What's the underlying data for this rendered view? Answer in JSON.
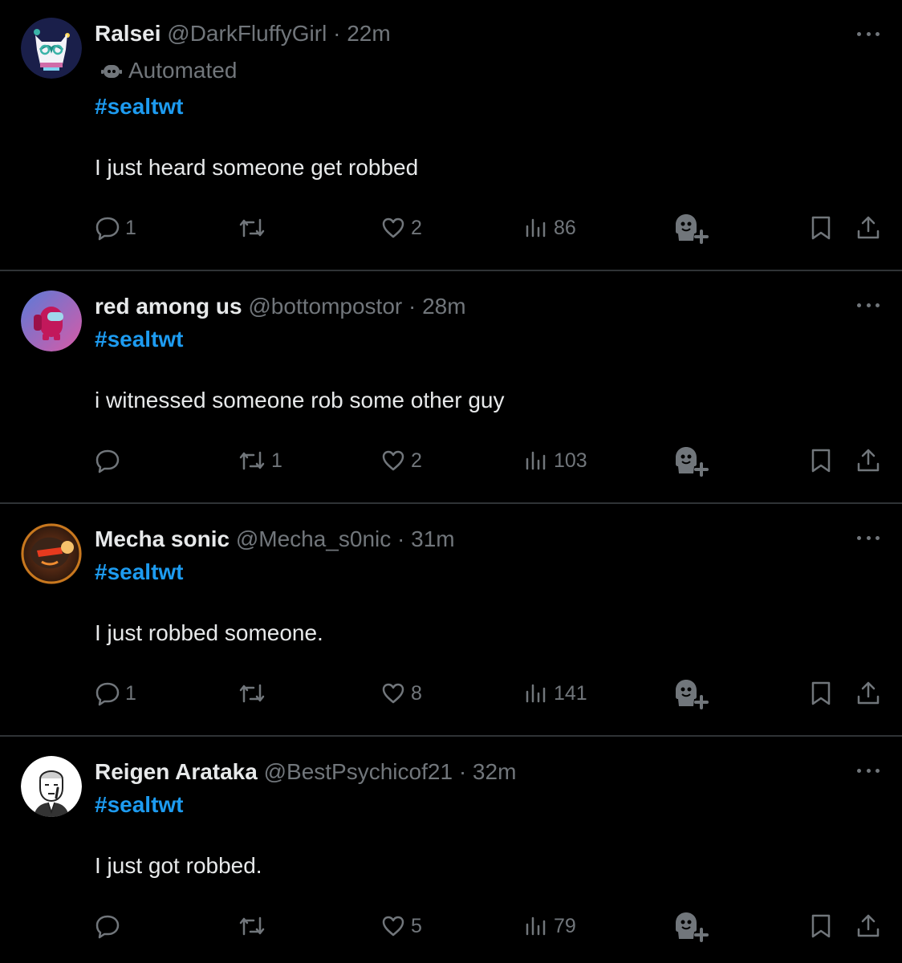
{
  "tweets": [
    {
      "name": "Ralsei",
      "handle": "@DarkFluffyGirl",
      "sep": "·",
      "time": "22m",
      "label": "Automated",
      "hashtag": "#sealtwt",
      "text": "I just heard someone get robbed",
      "replies": "1",
      "retweets": "",
      "likes": "2",
      "views": "86",
      "avatar_colors": [
        "#1a1f4a",
        "#e8e8f0",
        "#3bb3a8"
      ]
    },
    {
      "name": "red among us",
      "handle": "@bottompostor",
      "sep": "·",
      "time": "28m",
      "label": "",
      "hashtag": "#sealtwt",
      "text": "i witnessed someone rob some other guy",
      "replies": "",
      "retweets": "1",
      "likes": "2",
      "views": "103",
      "avatar_colors": [
        "#6a4fb0",
        "#c2185b",
        "#ff7a9a"
      ]
    },
    {
      "name": "Mecha sonic",
      "handle": "@Mecha_s0nic",
      "sep": "·",
      "time": "31m",
      "label": "",
      "hashtag": "#sealtwt",
      "text": "I just robbed someone.",
      "replies": "1",
      "retweets": "",
      "likes": "8",
      "views": "141",
      "avatar_colors": [
        "#2a1a12",
        "#d2691e",
        "#f5c16c"
      ]
    },
    {
      "name": "Reigen Arataka",
      "handle": "@BestPsychicof21",
      "sep": "·",
      "time": "32m",
      "label": "",
      "hashtag": "#sealtwt",
      "text": "I just got robbed.",
      "replies": "",
      "retweets": "",
      "likes": "5",
      "views": "79",
      "avatar_colors": [
        "#ffffff",
        "#222222",
        "#888888"
      ]
    }
  ],
  "colors": {
    "background": "#000000",
    "text_primary": "#e7e9ea",
    "text_secondary": "#71767b",
    "accent": "#1d9bf0",
    "divider": "#2f3336"
  },
  "icons": {
    "reply": "reply-icon",
    "retweet": "retweet-icon",
    "like": "heart-icon",
    "views": "views-icon",
    "grok": "grok-add-icon",
    "bookmark": "bookmark-icon",
    "share": "share-icon",
    "more": "more-options-icon",
    "automated": "bot-icon"
  }
}
